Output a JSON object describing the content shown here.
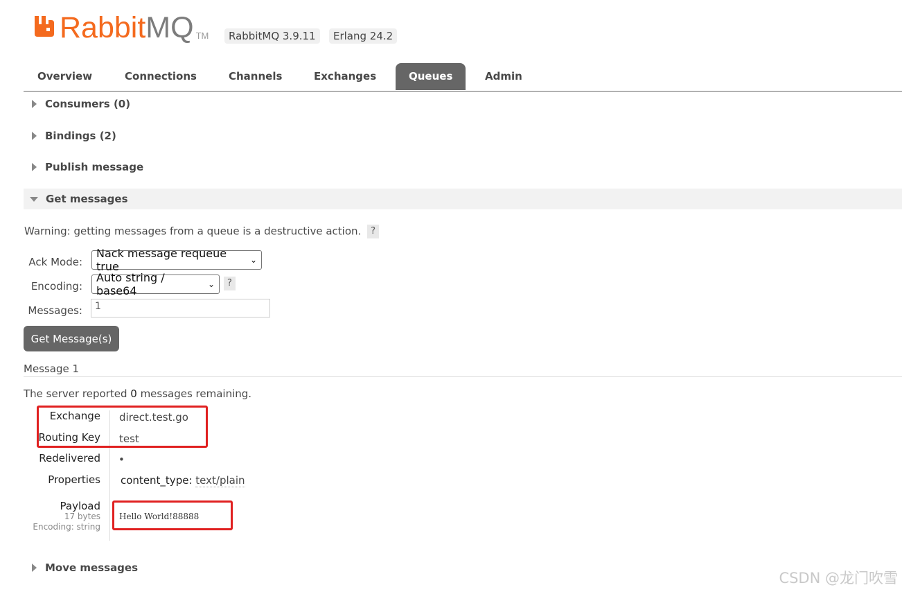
{
  "header": {
    "logo_brand": "Rabbit",
    "logo_product": "MQ",
    "logo_tm": "TM",
    "version_badge": "RabbitMQ 3.9.11",
    "erlang_badge": "Erlang 24.2",
    "brand_color": "#f46a1e"
  },
  "tabs": [
    {
      "label": "Overview"
    },
    {
      "label": "Connections"
    },
    {
      "label": "Channels"
    },
    {
      "label": "Exchanges"
    },
    {
      "label": "Queues",
      "active": true
    },
    {
      "label": "Admin"
    }
  ],
  "sections": {
    "consumers": "Consumers (0)",
    "bindings": "Bindings (2)",
    "publish": "Publish message",
    "get": "Get messages",
    "move": "Move messages"
  },
  "get_messages": {
    "warning": "Warning: getting messages from a queue is a destructive action.",
    "help": "?",
    "ack_mode_label": "Ack Mode:",
    "ack_mode_value": "Nack message requeue true",
    "encoding_label": "Encoding:",
    "encoding_value": "Auto string / base64",
    "messages_label": "Messages:",
    "messages_value": "1",
    "button": "Get Message(s)"
  },
  "result": {
    "heading": "Message 1",
    "remaining_prefix": "The server reported ",
    "remaining_count": "0",
    "remaining_suffix": " messages remaining.",
    "exchange_label": "Exchange",
    "exchange_value": "direct.test.go",
    "routing_key_label": "Routing Key",
    "routing_key_value": "test",
    "redelivered_label": "Redelivered",
    "redelivered_value": "•",
    "properties_label": "Properties",
    "property_key": "content_type:",
    "property_value": "text/plain",
    "payload_label": "Payload",
    "payload_size": "17 bytes",
    "payload_encoding": "Encoding: string",
    "payload_value": "Hello World!88888"
  },
  "watermark": "CSDN @龙门吹雪",
  "colors": {
    "tab_active_bg": "#666666",
    "highlight_box": "#e02020"
  }
}
